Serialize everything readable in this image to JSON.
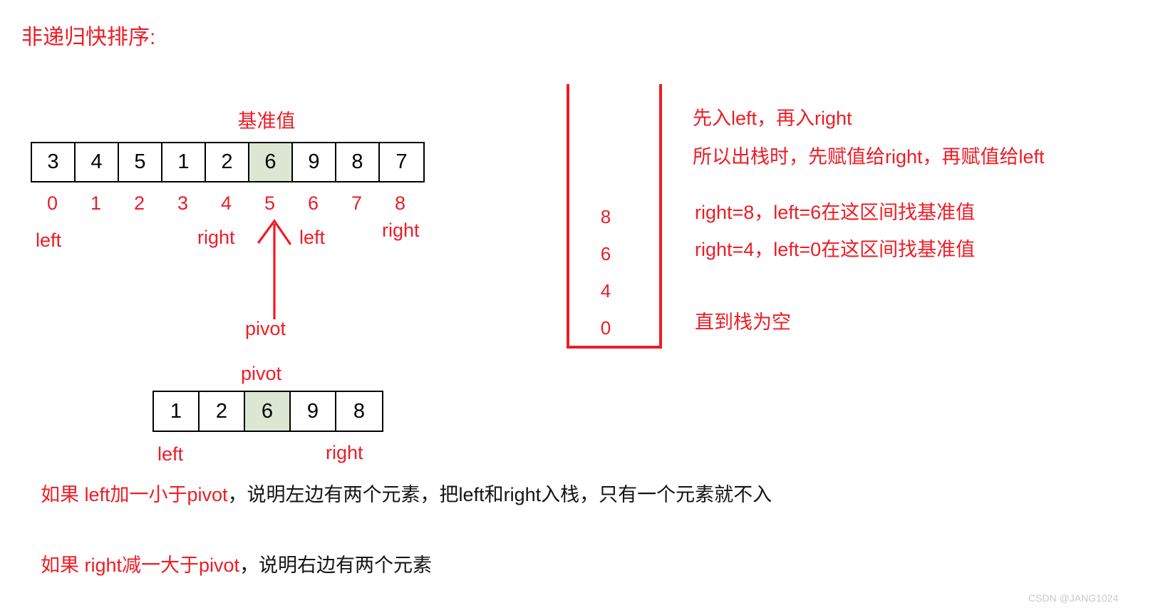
{
  "page": {
    "title": "非递归快排序:",
    "accent_red": "#ee1c25",
    "pivot_highlight": "#dbe7d2",
    "watermark": "CSDN @JANG1024"
  },
  "array1": {
    "caption": "基准值",
    "values": [
      "3",
      "4",
      "5",
      "1",
      "2",
      "6",
      "9",
      "8",
      "7"
    ],
    "indices": [
      "0",
      "1",
      "2",
      "3",
      "4",
      "5",
      "6",
      "7",
      "8"
    ],
    "pivot_index": 5,
    "pointers": {
      "left": "left",
      "right": "right",
      "left2": "left",
      "right2": "right"
    },
    "pivot_label": "pivot"
  },
  "stack": {
    "values": [
      "8",
      "6",
      "4",
      "0"
    ],
    "notes": [
      "先入left，再入right",
      "所以出栈时，先赋值给right，再赋值给left",
      "right=8，left=6在这区间找基准值",
      "right=4，left=0在这区间找基准值",
      "直到栈为空"
    ]
  },
  "array2": {
    "caption": "pivot",
    "values": [
      "1",
      "2",
      "6",
      "9",
      "8"
    ],
    "pivot_index": 2,
    "pointers": {
      "left": "left",
      "right": "right"
    }
  },
  "rules": [
    {
      "red": "如果 left加一小于pivot",
      "black": "，说明左边有两个元素，把left和right入栈，只有一个元素就不入"
    },
    {
      "red": "如果 right减一大于pivot",
      "black": "，说明右边有两个元素"
    }
  ]
}
